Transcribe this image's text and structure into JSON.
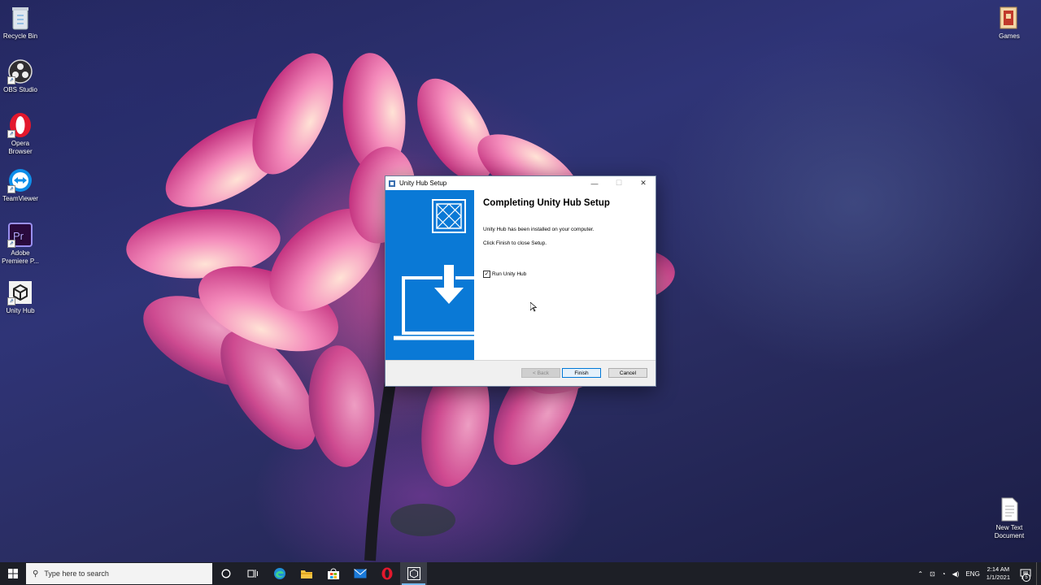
{
  "desktop": {
    "icons_left": [
      {
        "label": "Recycle Bin",
        "icon": "recycle-bin-icon"
      },
      {
        "label": "OBS Studio",
        "icon": "obs-studio-icon"
      },
      {
        "label": "Opera Browser",
        "icon": "opera-icon"
      },
      {
        "label": "TeamViewer",
        "icon": "teamviewer-icon"
      },
      {
        "label": "Adobe Premiere P...",
        "icon": "premiere-pro-icon"
      },
      {
        "label": "Unity Hub",
        "icon": "unity-hub-icon"
      }
    ],
    "icons_right": [
      {
        "label": "Games",
        "icon": "games-folder-icon"
      },
      {
        "label": "New Text Document",
        "icon": "text-document-icon"
      }
    ]
  },
  "dialog": {
    "title": "Unity Hub Setup",
    "minimize": "—",
    "maximize": "☐",
    "close": "✕",
    "heading": "Completing Unity Hub Setup",
    "line1": "Unity Hub has been installed on your computer.",
    "line2": "Click Finish to close Setup.",
    "checkbox_label": "Run Unity Hub",
    "checkbox_checked": true,
    "back_label": "< Back",
    "finish_label": "Finish",
    "cancel_label": "Cancel",
    "accent": "#0a79d6"
  },
  "taskbar": {
    "search_placeholder": "Type here to search",
    "pinned": [
      "task-view-icon",
      "edge-icon",
      "file-explorer-icon",
      "store-icon",
      "mail-icon",
      "opera-icon",
      "unity-hub-icon"
    ],
    "tray_lang": "ENG",
    "time": "2:14 AM",
    "date": "1/1/2021",
    "notification_count": "5"
  }
}
